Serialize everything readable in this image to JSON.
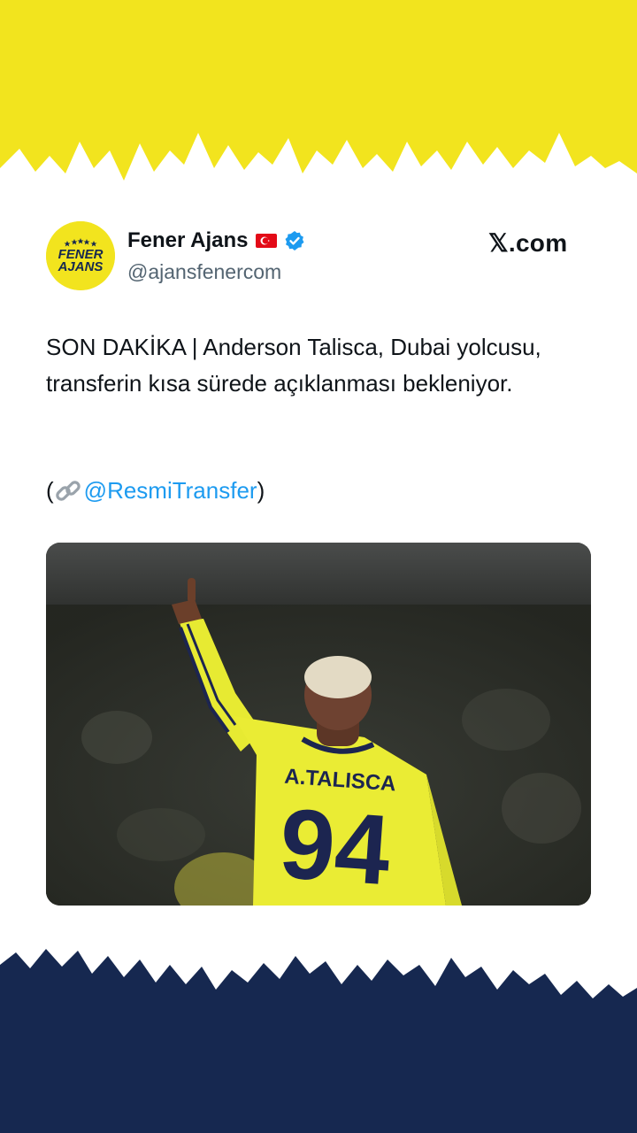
{
  "colors": {
    "top_band": "#f2e41e",
    "bottom_band": "#162850",
    "verified": "#1d9bf0",
    "link": "#1d9bf0",
    "text": "#0f1419",
    "muted": "#536471"
  },
  "tweet": {
    "avatar_text_line1": "FENER",
    "avatar_text_line2": "AJANS",
    "display_name": "Fener Ajans",
    "flag_icon": "turkey-flag-icon",
    "verified_icon": "verified-badge-icon",
    "handle": "@ajansfenercom",
    "source_site": "𝕏.com",
    "text": "SON DAKİKA | Anderson Talisca, Dubai yolcusu, transferin kısa sürede açıklanması bekleniyor.",
    "source_open": "(",
    "link_icon": "link-icon",
    "mention": "@ResmiTransfer",
    "source_close": ")",
    "image": {
      "jersey_name": "A.TALISCA",
      "jersey_number": "94"
    }
  }
}
